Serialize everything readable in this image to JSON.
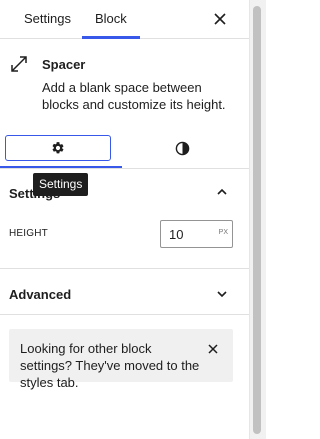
{
  "header": {
    "tabs": [
      {
        "label": "Settings"
      },
      {
        "label": "Block"
      }
    ],
    "active_tab": "Block",
    "close_icon": "close-icon"
  },
  "block": {
    "icon": "resize-arrows-icon",
    "title": "Spacer",
    "description": "Add a blank space between blocks and customize its height."
  },
  "subtabs": {
    "settings_icon": "gear-icon",
    "styles_icon": "half-circle-contrast-icon",
    "tooltip": "Settings"
  },
  "settings_section": {
    "title": "Settings",
    "expanded": true,
    "height": {
      "label": "HEIGHT",
      "value": "10",
      "unit": "PX"
    }
  },
  "advanced_section": {
    "title": "Advanced",
    "expanded": false
  },
  "notice": {
    "text": "Looking for other block settings? They've moved to the styles tab."
  },
  "colors": {
    "accent": "#3858e9",
    "notice_bg": "#f0f0f0",
    "tooltip_bg": "#1e1e1e"
  }
}
